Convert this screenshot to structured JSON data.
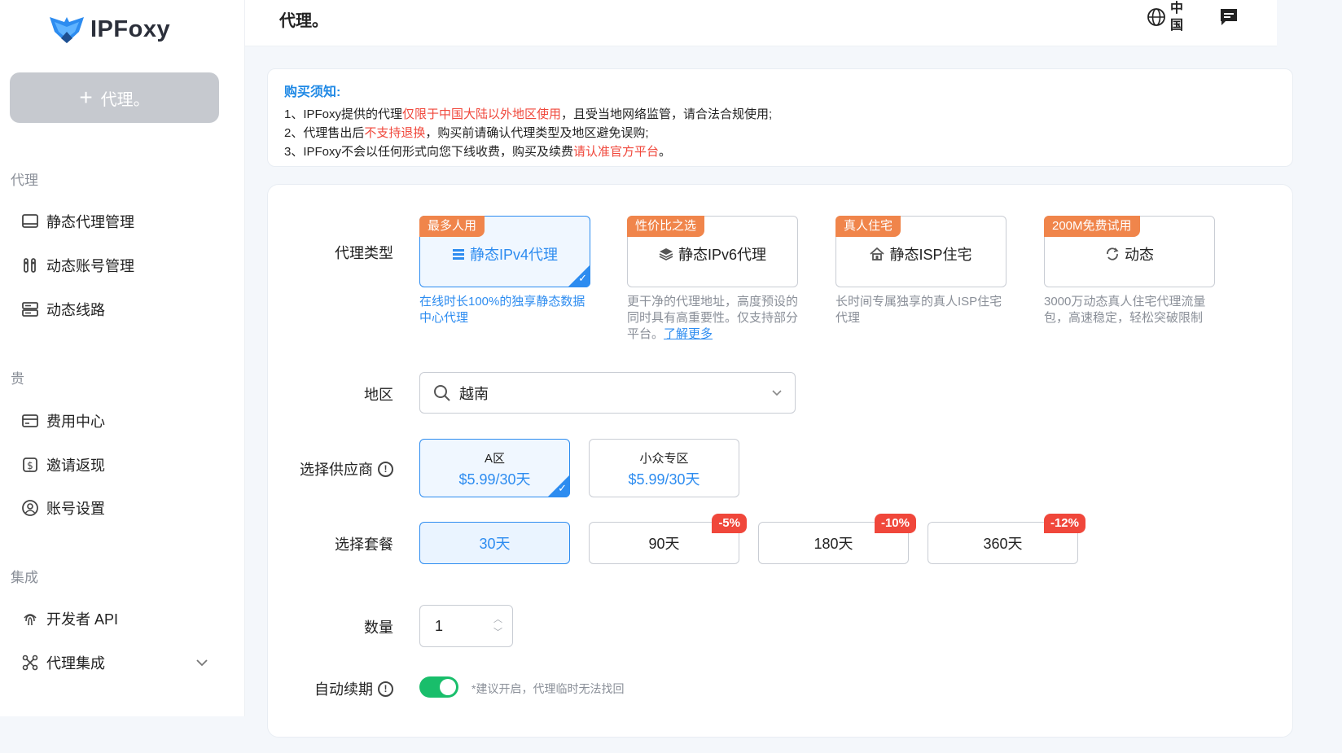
{
  "brand": {
    "name": "IPFoxy"
  },
  "sidebar": {
    "add_button": "代理。",
    "sections": [
      {
        "title": "代理",
        "items": [
          "静态代理管理",
          "动态账号管理",
          "动态线路"
        ]
      },
      {
        "title": "贵",
        "items": [
          "费用中心",
          "邀请返现",
          "账号设置"
        ]
      },
      {
        "title": "集成",
        "items": [
          "开发者 API",
          "代理集成"
        ]
      }
    ]
  },
  "header": {
    "title": "代理。",
    "language_line1": "中",
    "language_line2": "国"
  },
  "notice": {
    "title": "购买须知:",
    "line1": {
      "a": "1、IPFoxy提供的代理",
      "b": "仅限于中国大陆以外地区使用",
      "c": "，且受当地网络监管，请合法合规使用;"
    },
    "line2": {
      "a": "2、代理售出后",
      "b": "不支持退换",
      "c": "，购买前请确认代理类型及地区避免误购;"
    },
    "line3": {
      "a": "3、IPFoxy不会以任何形式向您下线收费，购买及续费",
      "b": "请认准官方平台",
      "c": "。"
    }
  },
  "form": {
    "proxy_type_label": "代理类型",
    "types": [
      {
        "tag": "最多人用",
        "name": "静态IPv4代理",
        "desc": "在线时长100%的独享静态数据中心代理"
      },
      {
        "tag": "性价比之选",
        "name": "静态IPv6代理",
        "desc": "更干净的代理地址，高度预设的同时具有高重要性。仅支持部分平台。",
        "link": "了解更多"
      },
      {
        "tag": "真人住宅",
        "name": "静态ISP住宅",
        "desc": "长时间专属独享的真人ISP住宅代理"
      },
      {
        "tag": "200M免费试用",
        "name": "动态",
        "desc": "3000万动态真人住宅代理流量包，高速稳定，轻松突破限制"
      }
    ],
    "region_label": "地区",
    "region_value": "越南",
    "supplier_label": "选择供应商",
    "suppliers": [
      {
        "name": "A区",
        "price": "$5.99/30天"
      },
      {
        "name": "小众专区",
        "price": "$5.99/30天"
      }
    ],
    "plan_label": "选择套餐",
    "plans": [
      {
        "label": "30天",
        "discount": ""
      },
      {
        "label": "90天",
        "discount": "-5%"
      },
      {
        "label": "180天",
        "discount": "-10%"
      },
      {
        "label": "360天",
        "discount": "-12%"
      }
    ],
    "quantity_label": "数量",
    "quantity_value": "1",
    "auto_renew_label": "自动续期",
    "auto_renew_hint": "*建议开启，代理临时无法找回",
    "auto_renew_on": true
  },
  "colors": {
    "accent": "#2d8cf0",
    "tag": "#f0854b",
    "danger": "#f0473b",
    "toggle_on": "#19be6b"
  }
}
